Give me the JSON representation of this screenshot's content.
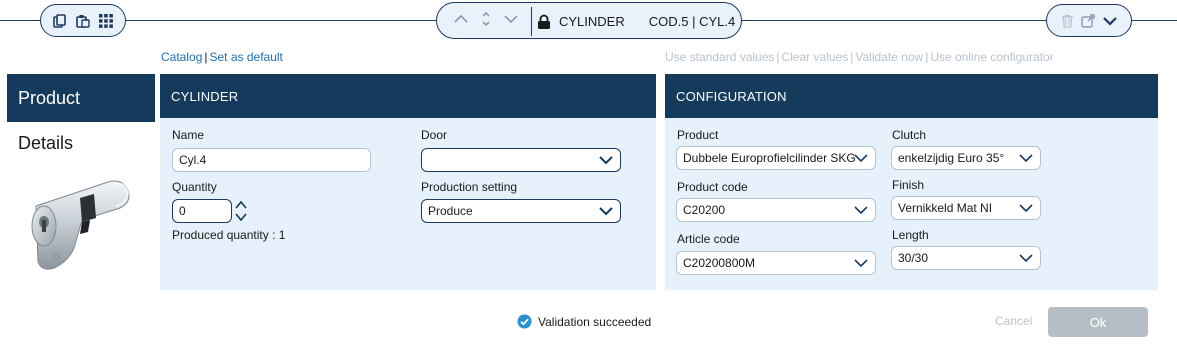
{
  "toolbar": {
    "left_icons": [
      "copy-icon",
      "paste-icon",
      "grid-icon"
    ],
    "title": "CYLINDER",
    "code": "COD.5 | CYL.4",
    "right_icons": [
      "trash-icon",
      "external-link-icon",
      "chevron-down-icon"
    ]
  },
  "links_left": {
    "catalog": "Catalog",
    "separator": "|",
    "set_default": "Set as default"
  },
  "links_right": {
    "use_standard": "Use standard values",
    "clear": "Clear values",
    "validate": "Validate now",
    "configurator": "Use online configurator",
    "separator": "|"
  },
  "sidebar": {
    "items": [
      {
        "label": "Product"
      },
      {
        "label": "Details"
      }
    ]
  },
  "cylinder": {
    "header": "CYLINDER",
    "name_label": "Name",
    "name_value": "Cyl.4",
    "door_label": "Door",
    "door_value": "",
    "quantity_label": "Quantity",
    "quantity_value": "0",
    "production_label": "Production setting",
    "production_value": "Produce",
    "produced_qty": "Produced quantity : 1"
  },
  "configuration": {
    "header": "CONFIGURATION",
    "product_label": "Product",
    "product_value": "Dubbele Europrofielcilinder SKG",
    "product_code_label": "Product code",
    "product_code_value": "C20200",
    "article_code_label": "Article code",
    "article_code_value": "C20200800M",
    "clutch_label": "Clutch",
    "clutch_value": "enkelzijdig Euro 35°",
    "finish_label": "Finish",
    "finish_value": "Vernikkeld Mat NI",
    "length_label": "Length",
    "length_value": "30/30"
  },
  "footer": {
    "status": "Validation succeeded",
    "cancel": "Cancel",
    "ok": "Ok"
  },
  "colors": {
    "header_bg": "#143a5c",
    "panel_bg": "#e7f1fb",
    "link": "#1d6fb5",
    "disabled": "#b7c3cf",
    "success": "#2b8fd6",
    "ok_button": "#b6bec5"
  }
}
